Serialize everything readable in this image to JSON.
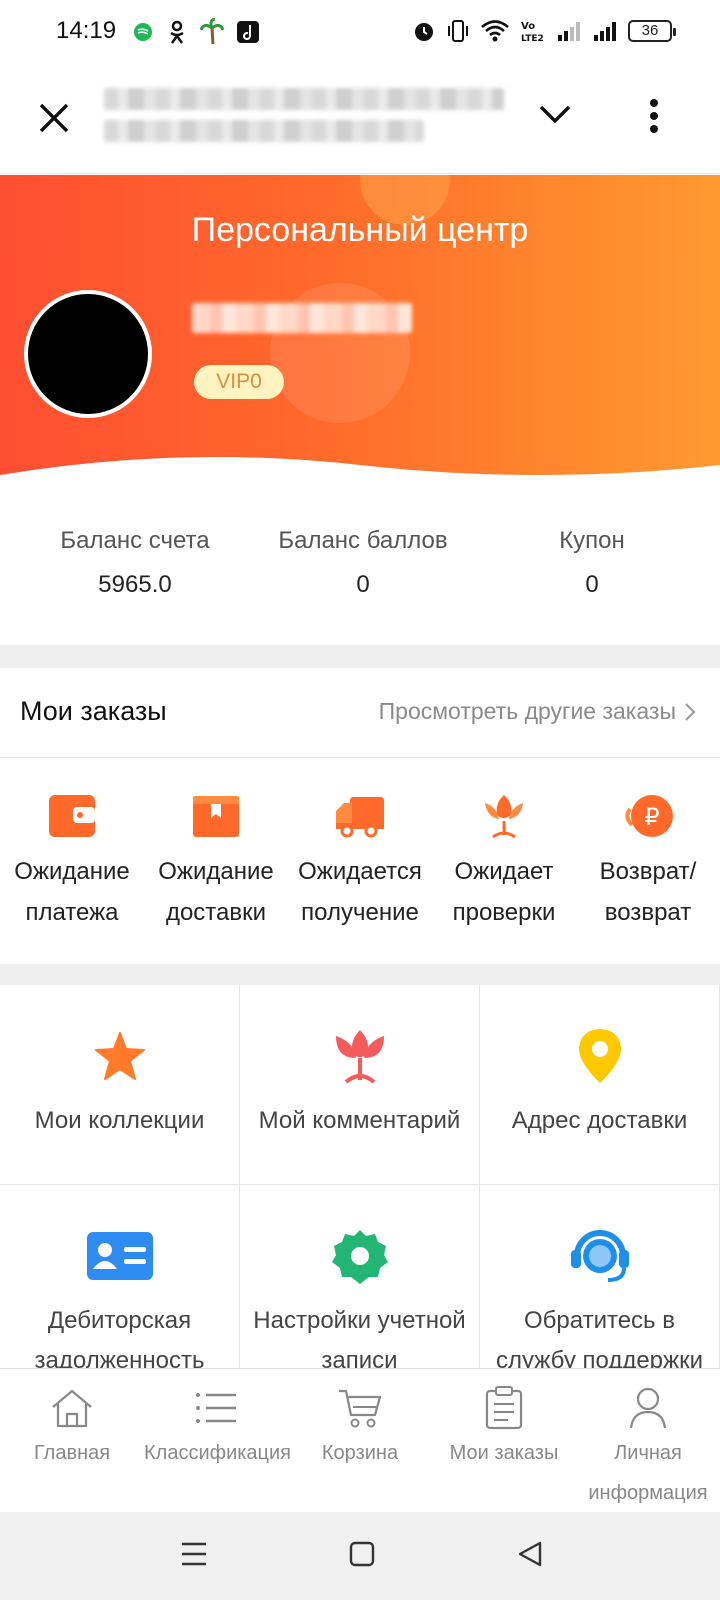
{
  "status": {
    "time": "14:19",
    "battery": "36",
    "notification_icons": [
      "messenger-icon",
      "ok-icon",
      "palm-icon",
      "music-icon"
    ],
    "system_icons": [
      "alarm-icon",
      "vibrate-icon",
      "wifi-icon",
      "volte-icon",
      "signal-icon",
      "signal-icon"
    ]
  },
  "header": {
    "title": "Персональный центр",
    "vip_badge": "VIP0",
    "colors": {
      "gradient_start": "#ff4e32",
      "gradient_end": "#ff9a30"
    }
  },
  "balances": [
    {
      "label": "Баланс счета",
      "value": "5965.0"
    },
    {
      "label": "Баланс баллов",
      "value": "0"
    },
    {
      "label": "Купон",
      "value": "0"
    }
  ],
  "orders": {
    "title": "Мои заказы",
    "view_more": "Просмотреть другие заказы",
    "items": [
      {
        "line1": "Ожидание",
        "line2": "платежа",
        "icon": "wallet-icon"
      },
      {
        "line1": "Ожидание",
        "line2": "доставки",
        "icon": "box-icon"
      },
      {
        "line1": "Ожидается",
        "line2": "получение",
        "icon": "truck-icon"
      },
      {
        "line1": "Ожидает",
        "line2": "проверки",
        "icon": "flower-icon"
      },
      {
        "line1": "Возврат/",
        "line2": "возврат",
        "icon": "ruble-refund-icon"
      }
    ]
  },
  "grid": [
    {
      "line1": "Мои коллекции",
      "line2": "",
      "icon": "star-icon",
      "color": "#ff7a2a"
    },
    {
      "line1": "Мой комментарий",
      "line2": "",
      "icon": "tulip-icon",
      "color": "#f45b5b"
    },
    {
      "line1": "Адрес доставки",
      "line2": "",
      "icon": "location-pin-icon",
      "color": "#ffc800"
    },
    {
      "line1": "Дебиторская",
      "line2": "задолженность",
      "icon": "id-card-icon",
      "color": "#2e8cf0"
    },
    {
      "line1": "Настройки учетной",
      "line2": "записи",
      "icon": "gear-icon",
      "color": "#22b573"
    },
    {
      "line1": "Обратитесь в",
      "line2": "службу поддержки",
      "icon": "headset-icon",
      "color": "#1e8ee8"
    }
  ],
  "tabs": [
    {
      "line1": "Главная",
      "line2": "",
      "icon": "home-icon"
    },
    {
      "line1": "Классификация",
      "line2": "",
      "icon": "list-icon"
    },
    {
      "line1": "Корзина",
      "line2": "",
      "icon": "cart-icon"
    },
    {
      "line1": "Мои заказы",
      "line2": "",
      "icon": "clipboard-icon"
    },
    {
      "line1": "Личная",
      "line2": "информация",
      "icon": "user-icon"
    }
  ],
  "accent_color": "#ff6a2a"
}
